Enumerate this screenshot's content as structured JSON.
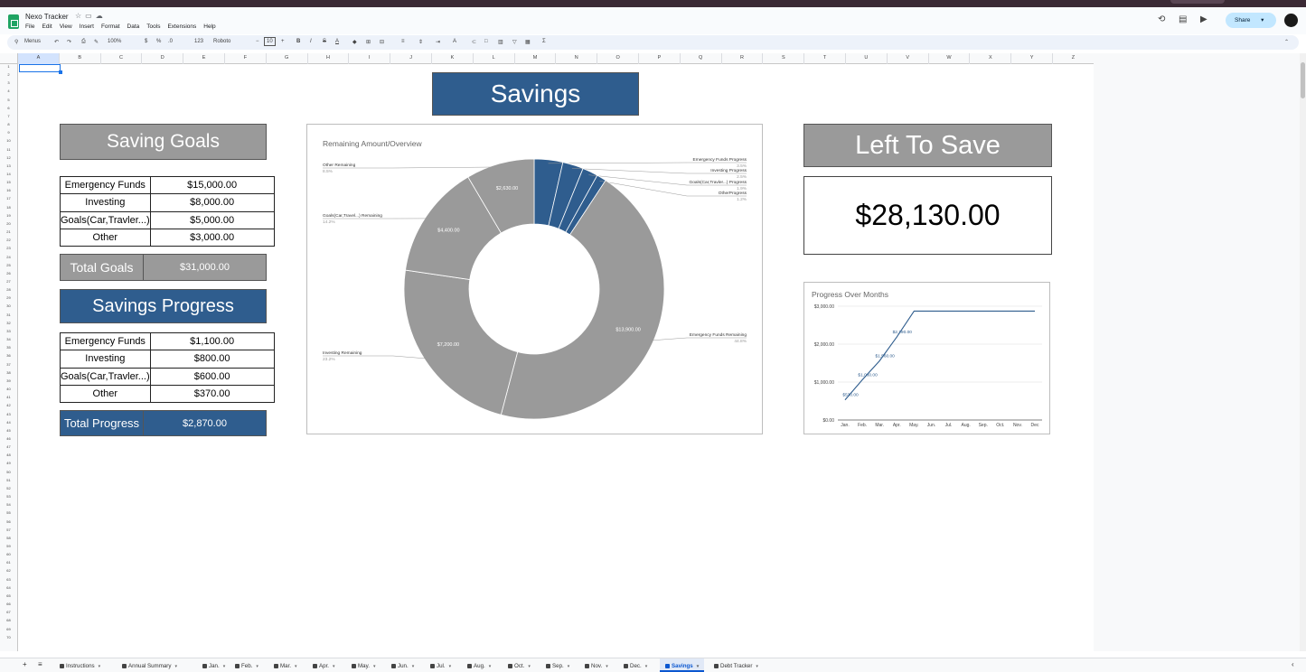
{
  "app": {
    "title": "Nexo Tracker",
    "menu": [
      "File",
      "Edit",
      "View",
      "Insert",
      "Format",
      "Data",
      "Tools",
      "Extensions",
      "Help"
    ],
    "share_label": "Share",
    "menus_search": "Menus",
    "zoom": "100%",
    "font": "Roboto",
    "font_size": "10",
    "currency": "$",
    "percent": "%",
    "decimals": ".0",
    "number_format": "123"
  },
  "columns": [
    "A",
    "B",
    "C",
    "D",
    "E",
    "F",
    "G",
    "H",
    "I",
    "J",
    "K",
    "L",
    "M",
    "N",
    "O",
    "P",
    "Q",
    "R",
    "S",
    "T",
    "U",
    "V",
    "W",
    "X",
    "Y",
    "Z"
  ],
  "savings_banner": "Savings",
  "goals": {
    "header": "Saving Goals",
    "rows": [
      {
        "label": "Emergency Funds",
        "value": "$15,000.00"
      },
      {
        "label": "Investing",
        "value": "$8,000.00"
      },
      {
        "label": "Goals(Car,Travler...)",
        "value": "$5,000.00"
      },
      {
        "label": "Other",
        "value": "$3,000.00"
      }
    ],
    "total_label": "Total Goals",
    "total_value": "$31,000.00"
  },
  "progress": {
    "header": "Savings Progress",
    "rows": [
      {
        "label": "Emergency Funds",
        "value": "$1,100.00"
      },
      {
        "label": "Investing",
        "value": "$800.00"
      },
      {
        "label": "Goals(Car,Travler...)",
        "value": "$600.00"
      },
      {
        "label": "Other",
        "value": "$370.00"
      }
    ],
    "total_label": "Total Progress",
    "total_value": "$2,870.00"
  },
  "left_to_save": {
    "header": "Left To Save",
    "value": "$28,130.00"
  },
  "chart_data": [
    {
      "type": "pie",
      "title": "Remaining Amount/Overview",
      "donut": true,
      "slices": [
        {
          "name": "Emergency Funds Progress",
          "value": 1100,
          "pct": "3.5%",
          "color": "#2f5d8e",
          "label": ""
        },
        {
          "name": "Investing Progress",
          "value": 800,
          "pct": "2.5%",
          "color": "#2f5d8e",
          "label": ""
        },
        {
          "name": "Goals(Car,Travler...) Progress",
          "value": 600,
          "pct": "1.9%",
          "color": "#2f5d8e",
          "label": ""
        },
        {
          "name": "OtherProgress",
          "value": 370,
          "pct": "1.2%",
          "color": "#2f5d8e",
          "label": ""
        },
        {
          "name": "Emergency Funds Remaining",
          "value": 13900,
          "pct": "44.8%",
          "color": "#9a9a9a",
          "label": "$13,900.00"
        },
        {
          "name": "Investing Remaining",
          "value": 7200,
          "pct": "23.2%",
          "color": "#9a9a9a",
          "label": "$7,200.00"
        },
        {
          "name": "Goals(Car,Travel...) Remaining",
          "value": 4400,
          "pct": "14.2%",
          "color": "#9a9a9a",
          "label": "$4,400.00"
        },
        {
          "name": "Other Remaining",
          "value": 2630,
          "pct": "8.5%",
          "color": "#9a9a9a",
          "label": "$2,630.00"
        }
      ]
    },
    {
      "type": "line",
      "title": "Progress Over Months",
      "categories": [
        "Jan.",
        "Feb.",
        "Mar.",
        "Apr.",
        "May.",
        "Jun.",
        "Jul.",
        "Aug.",
        "Sep.",
        "Oct.",
        "Nov.",
        "Dec"
      ],
      "series": [
        {
          "values": [
            530,
            1060,
            1560,
            2190,
            2870,
            2870,
            2870,
            2870,
            2870,
            2870,
            2870,
            2870
          ],
          "color": "#2f5d8e"
        }
      ],
      "point_labels": [
        "$530.00",
        "$1,060.00",
        "$1,560.00",
        "$2,190.00"
      ],
      "yticks": [
        "$0.00",
        "$1,000.00",
        "$2,000.00",
        "$3,000.00"
      ],
      "ylim": [
        0,
        3000
      ],
      "grid": true
    }
  ],
  "sheet_tabs": [
    {
      "label": "Instructions",
      "locked": true
    },
    {
      "label": "Annual Summary",
      "locked": true
    },
    {
      "label": "Jan.",
      "locked": true
    },
    {
      "label": "Feb.",
      "locked": true
    },
    {
      "label": "Mar.",
      "locked": true
    },
    {
      "label": "Apr.",
      "locked": true
    },
    {
      "label": "May.",
      "locked": true
    },
    {
      "label": "Jun.",
      "locked": true
    },
    {
      "label": "Jul.",
      "locked": true
    },
    {
      "label": "Aug.",
      "locked": true
    },
    {
      "label": "Oct.",
      "locked": true
    },
    {
      "label": "Sep.",
      "locked": true
    },
    {
      "label": "Nov.",
      "locked": true
    },
    {
      "label": "Dec.",
      "locked": true
    },
    {
      "label": "Savings",
      "locked": true,
      "active": true
    },
    {
      "label": "Debt Tracker",
      "locked": true
    }
  ]
}
